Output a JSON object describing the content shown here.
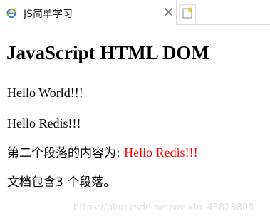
{
  "browser": {
    "tab": {
      "title": "JS简单学习",
      "favicon": "ie-icon",
      "close_icon": "close-icon"
    },
    "new_tab_icon": "new-tab-icon"
  },
  "content": {
    "heading": "JavaScript HTML DOM",
    "paragraphs": [
      "Hello World!!!",
      "Hello Redis!!!"
    ],
    "second_para_label": "第二个段落的内容为: ",
    "second_para_value": "Hello Redis!!!",
    "count_text": "文档包含3 个段落。"
  },
  "watermark": "https://blog.csdn.net/weixin_43823808",
  "colors": {
    "highlight": "#ff0000",
    "watermark": "#e2e2e2"
  }
}
